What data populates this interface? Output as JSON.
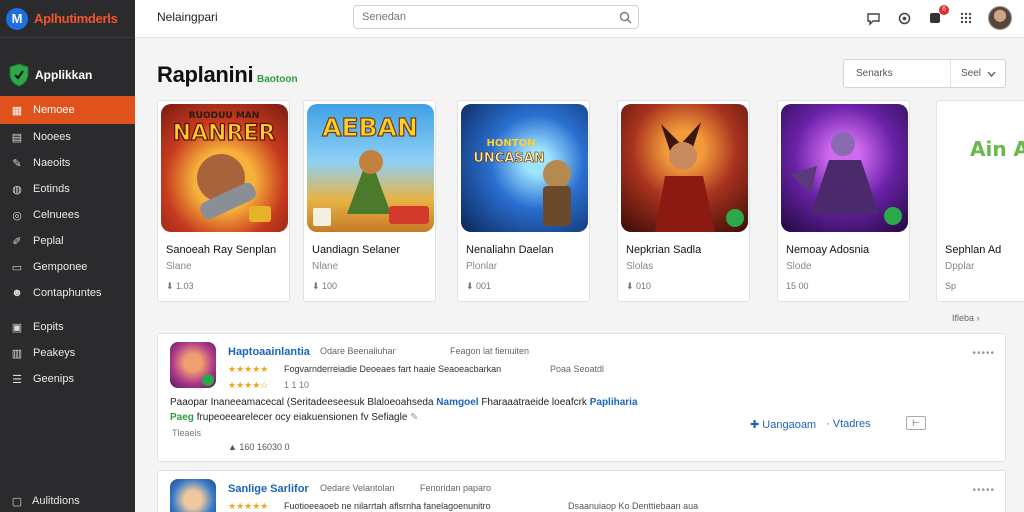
{
  "brand": {
    "logo_letter": "M",
    "name": "Aplhutimderls"
  },
  "app_badge": {
    "label": "Applikkan"
  },
  "sidebar": {
    "items": [
      {
        "label": "Nemoee",
        "icon": "apps-icon",
        "active": true
      },
      {
        "label": "Nooees",
        "icon": "list-icon",
        "active": false
      },
      {
        "label": "Naeoits",
        "icon": "wrench-icon",
        "active": false
      },
      {
        "label": "Eotinds",
        "icon": "gamepad-icon",
        "active": false
      },
      {
        "label": "Celnuees",
        "icon": "compass-icon",
        "active": false
      },
      {
        "label": "Peplal",
        "icon": "pen-icon",
        "active": false
      },
      {
        "label": "Gemponee",
        "icon": "inbox-icon",
        "active": false
      },
      {
        "label": "Contaphuntes",
        "icon": "people-icon",
        "active": false
      },
      {
        "label": "Eopits",
        "icon": "briefcase-icon",
        "active": false
      },
      {
        "label": "Peakeys",
        "icon": "columns-icon",
        "active": false
      },
      {
        "label": "Geenips",
        "icon": "filter-icon",
        "active": false
      }
    ],
    "footer": {
      "label": "Aulitdions",
      "icon": "window-icon"
    }
  },
  "topbar": {
    "title": "Nelaingpari",
    "search_placeholder": "Senedan",
    "notification_count": "6"
  },
  "section": {
    "title": "Raplanini",
    "subtitle": "Baotoon"
  },
  "sort": {
    "label": "Senarks",
    "value": "Seel"
  },
  "featured": [
    {
      "art_text": "NANRER",
      "art_top": "RUODUU MAN",
      "title": "Sanoeah Ray Senplan",
      "dev": "Slane",
      "stat": "1.03"
    },
    {
      "art_text": "AEBAN",
      "art_top": "",
      "title": "Uandiagn Selaner",
      "dev": "Nlane",
      "stat": "100"
    },
    {
      "art_text": "UNCASAN",
      "art_top": "HONTON",
      "title": "Nenaliahn Daelan",
      "dev": "Plonlar",
      "stat": "001"
    },
    {
      "art_text": "",
      "art_top": "",
      "title": "Nepkrian Sadla",
      "dev": "Slolas",
      "stat": "010"
    },
    {
      "art_text": "",
      "art_top": "",
      "title": "Nemoay Adosnia",
      "dev": "Slode",
      "stat": "15 00"
    },
    {
      "art_text": "Ain Arh",
      "art_top": "",
      "title": "Sephlan Ad",
      "dev": "Dpplar",
      "stat": "Sp"
    }
  ],
  "see_all": "Ifleba",
  "rows": [
    {
      "title": "Haptoaainlantia",
      "meta1": "Odare Beenaliuhar",
      "meta2": "Feagon lat fienuiten",
      "stars": "★★★★★",
      "line1": "Fogvarnderreiadie Deoeaes fart haaie Seaoeacbarkan",
      "line1_extra": "Poaa Seoatdl",
      "rating": "★★★★☆",
      "rating_count": "1 1 10",
      "desc1": "Paaopar Inaneeamacecal (Seritadeeseesuk Blaloeoahseda",
      "desc1_accent": "Namgoel",
      "desc1_rest": "Fharaaatraeide loeafcrk",
      "desc1_end": "Papliharia",
      "desc2_green": "Paeg",
      "desc2": "frupeoeearelecer ocy eiakuensionen fv Sefiagle",
      "label3": "Tleaeis",
      "stats": "160 16030 0",
      "action": "Uangaoam",
      "action2": "Vtadres"
    },
    {
      "title": "Sanlige Sarlifor",
      "meta1": "Oedare Velantolan",
      "meta2": "Fenoridan paparo",
      "stars": "★★★★★",
      "line1": "Fuotioeeaoeb ne nilarrtah aflsrnha fanelagoenunitro",
      "line1_extra": "Dsaanuiaop Ko Denttiebaan aua"
    }
  ],
  "colors": {
    "accent": "#e0521c",
    "link": "#1a65b8",
    "green": "#2c9c3c",
    "sidebar": "#2b2b2d"
  }
}
